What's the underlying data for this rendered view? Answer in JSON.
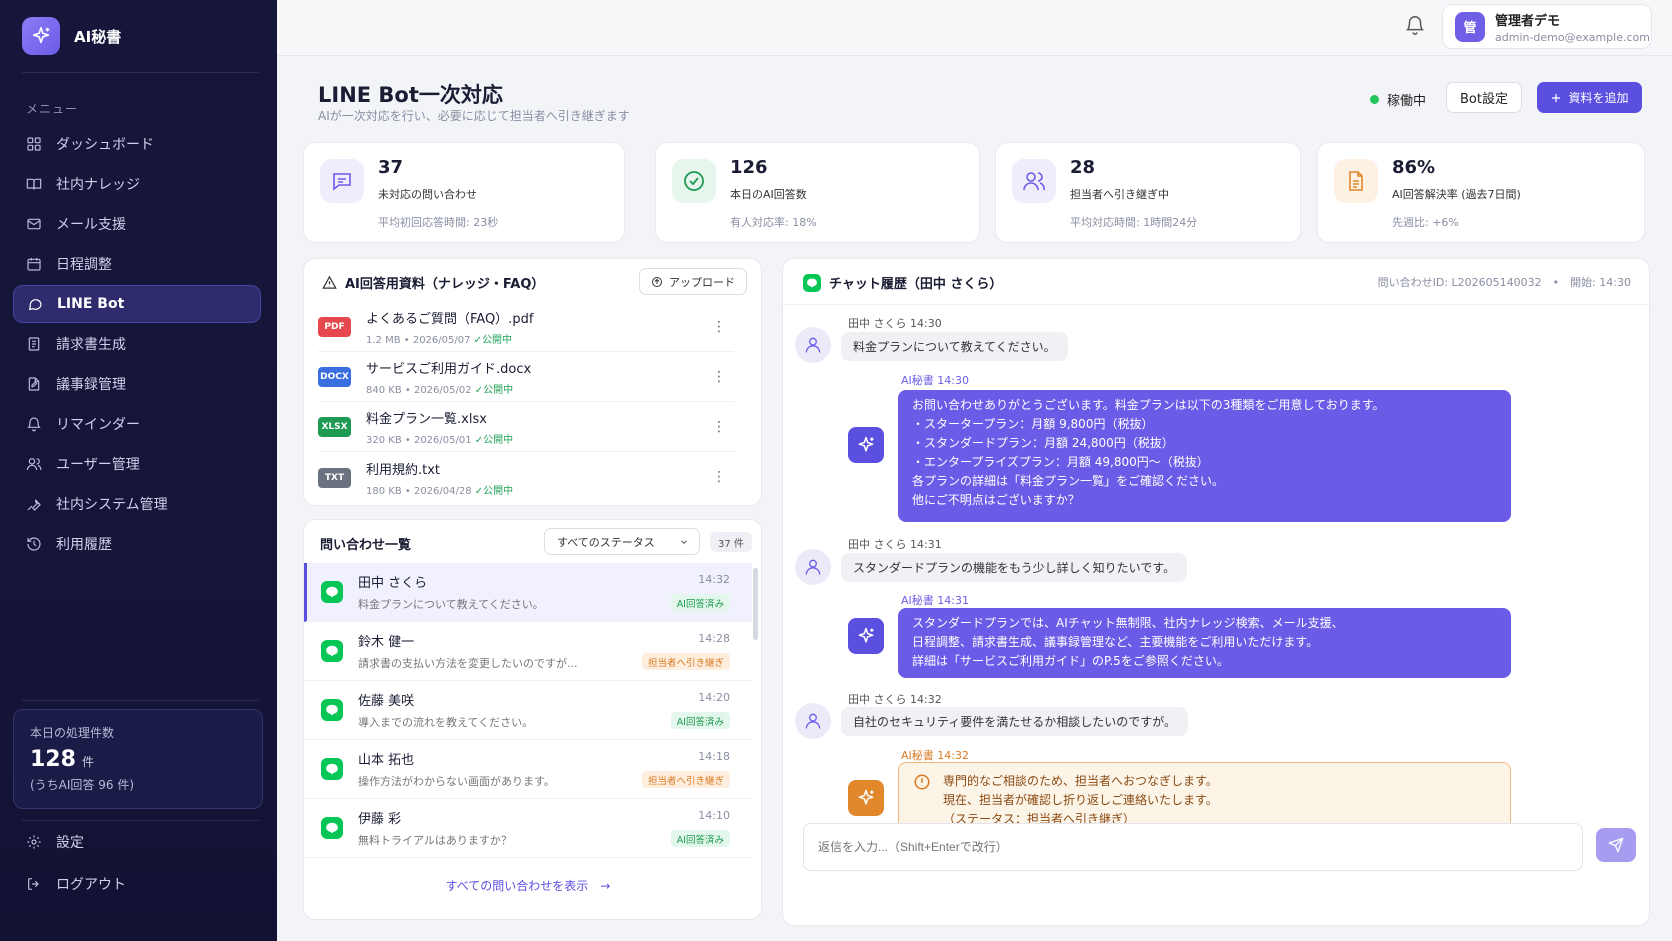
{
  "app": {
    "name": "AI秘書"
  },
  "sidebar": {
    "menu_label": "メニュー",
    "items": [
      {
        "label": "ダッシュボード",
        "icon": "grid-icon"
      },
      {
        "label": "社内ナレッジ",
        "icon": "book-icon"
      },
      {
        "label": "メール支援",
        "icon": "mail-icon"
      },
      {
        "label": "日程調整",
        "icon": "calendar-icon"
      },
      {
        "label": "LINE Bot",
        "icon": "chat-bubble-icon",
        "active": true
      },
      {
        "label": "請求書生成",
        "icon": "invoice-icon"
      },
      {
        "label": "議事録管理",
        "icon": "document-edit-icon"
      },
      {
        "label": "リマインダー",
        "icon": "bell-icon"
      },
      {
        "label": "ユーザー管理",
        "icon": "users-icon"
      },
      {
        "label": "社内システム管理",
        "icon": "wrench-icon"
      },
      {
        "label": "利用履歴",
        "icon": "history-icon"
      }
    ],
    "stats": {
      "label": "本日の処理件数",
      "value": "128",
      "unit": "件",
      "sub": "(うちAI回答 96 件)"
    },
    "settings": "設定",
    "logout": "ログアウト"
  },
  "topbar": {
    "user_initial": "管",
    "user_name": "管理者デモ",
    "user_email": "admin-demo@example.com"
  },
  "header": {
    "title": "LINE Bot一次対応",
    "subtitle": "AIが一次対応を行い、必要に応じて担当者へ引き継ぎます",
    "status": "稼働中",
    "bot_settings": "Bot設定",
    "add_material": "資料を追加"
  },
  "stats": [
    {
      "value": "37",
      "label": "未対応の問い合わせ",
      "note": "平均初回応答時間: 23秒",
      "icon": "message-icon",
      "color": "#6b5ce7",
      "bg": "#efedfc"
    },
    {
      "value": "126",
      "label": "本日のAI回答数",
      "note": "有人対応率: 18%",
      "icon": "check-circle-icon",
      "color": "#1f9a52",
      "bg": "#e6f6ec"
    },
    {
      "value": "28",
      "label": "担当者へ引き継ぎ中",
      "note": "平均対応時間: 1時間24分",
      "icon": "users-icon",
      "color": "#6b5ce7",
      "bg": "#efedfc"
    },
    {
      "value": "86%",
      "label": "AI回答解決率 (過去7日間)",
      "note": "先週比: +6%",
      "icon": "file-text-icon",
      "color": "#e0882b",
      "bg": "#fdf1e4"
    }
  ],
  "knowledge": {
    "title": "AI回答用資料（ナレッジ・FAQ）",
    "upload": "アップロード",
    "files": [
      {
        "tag": "PDF",
        "tag_color": "#e5484d",
        "name": "よくあるご質問（FAQ）.pdf",
        "size": "1.2 MB",
        "date": "2026/05/07",
        "status": "公開中"
      },
      {
        "tag": "DOCX",
        "tag_color": "#3b6fe0",
        "name": "サービスご利用ガイド.docx",
        "size": "840 KB",
        "date": "2026/05/02",
        "status": "公開中"
      },
      {
        "tag": "XLSX",
        "tag_color": "#1f9a52",
        "name": "料金プラン一覧.xlsx",
        "size": "320 KB",
        "date": "2026/05/01",
        "status": "公開中"
      },
      {
        "tag": "TXT",
        "tag_color": "#6b7280",
        "name": "利用規約.txt",
        "size": "180 KB",
        "date": "2026/04/28",
        "status": "公開中"
      }
    ]
  },
  "inquiries": {
    "title": "問い合わせ一覧",
    "filter": "すべてのステータス",
    "count": "37 件",
    "items": [
      {
        "name": "田中 さくら",
        "message": "料金プランについて教えてください。",
        "time": "14:32",
        "badge": "AI回答済み",
        "badge_type": "ai"
      },
      {
        "name": "鈴木 健一",
        "message": "請求書の支払い方法を変更したいのですが...",
        "time": "14:28",
        "badge": "担当者へ引き継ぎ",
        "badge_type": "hand"
      },
      {
        "name": "佐藤 美咲",
        "message": "導入までの流れを教えてください。",
        "time": "14:20",
        "badge": "AI回答済み",
        "badge_type": "ai"
      },
      {
        "name": "山本 拓也",
        "message": "操作方法がわからない画面があります。",
        "time": "14:18",
        "badge": "担当者へ引き継ぎ",
        "badge_type": "hand"
      },
      {
        "name": "伊藤 彩",
        "message": "無料トライアルはありますか？",
        "time": "14:10",
        "badge": "AI回答済み",
        "badge_type": "ai"
      }
    ],
    "view_all": "すべての問い合わせを表示　→"
  },
  "chat": {
    "title": "チャット履歴（田中 さくら）",
    "meta": "問い合わせID: L202605140032　•　開始: 14:30",
    "messages": [
      {
        "who": "田中 さくら  14:30",
        "text": "料金プランについて教えてください。"
      },
      {
        "who": "AI秘書  14:30",
        "lines": [
          "お問い合わせありがとうございます。料金プランは以下の3種類をご用意しております。",
          "・スタータープラン：月額 9,800円（税抜）",
          "・スタンダードプラン：月額 24,800円（税抜）",
          "・エンタープライズプラン：月額 49,800円〜（税抜）",
          "各プランの詳細は「料金プラン一覧」をご確認ください。",
          "他にご不明点はございますか？"
        ]
      },
      {
        "who": "田中 さくら  14:31",
        "text": "スタンダードプランの機能をもう少し詳しく知りたいです。"
      },
      {
        "who": "AI秘書  14:31",
        "lines": [
          "スタンダードプランでは、AIチャット無制限、社内ナレッジ検索、メール支援、",
          "日程調整、請求書生成、議事録管理など、主要機能をご利用いただけます。",
          "詳細は「サービスご利用ガイド」のP.5をご参照ください。"
        ]
      },
      {
        "who": "田中 さくら  14:32",
        "text": "自社のセキュリティ要件を満たせるか相談したいのですが。"
      },
      {
        "who": "AI秘書  14:32",
        "lines": [
          "専門的なご相談のため、担当者へおつなぎします。",
          "現在、担当者が確認し折り返しご連絡いたします。",
          "（ステータス：担当者へ引き継ぎ）"
        ]
      }
    ],
    "reply_placeholder": "返信を入力...（Shift+Enterで改行）"
  }
}
